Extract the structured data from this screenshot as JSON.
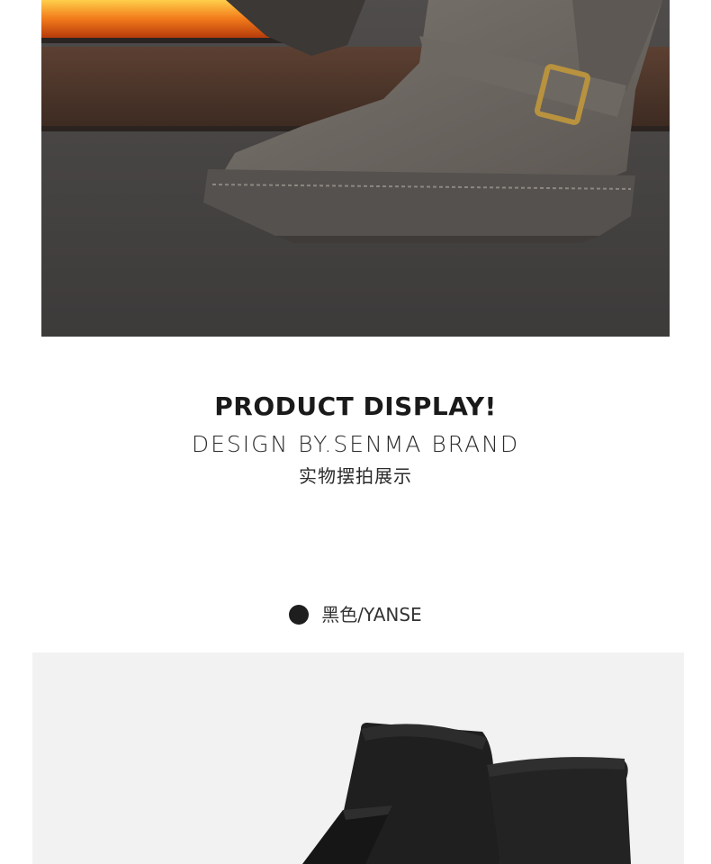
{
  "section": {
    "title": "PRODUCT DISPLAY!",
    "subtitle": "DESIGN BY.SENMA BRAND",
    "caption_cn": "实物摆拍展示"
  },
  "color_option": {
    "label": "黑色/YANSE",
    "swatch": "#1e1e1e"
  },
  "images": {
    "top": "grey-suede-snow-boot-buckle-fireplace-photo",
    "bottom": "black-suede-snow-boot-photo"
  },
  "colors": {
    "boot_grey": "#6b6661",
    "boot_black": "#1f1f1f",
    "buckle_gold": "#b8923e",
    "fire_orange": "#f27a1a"
  }
}
